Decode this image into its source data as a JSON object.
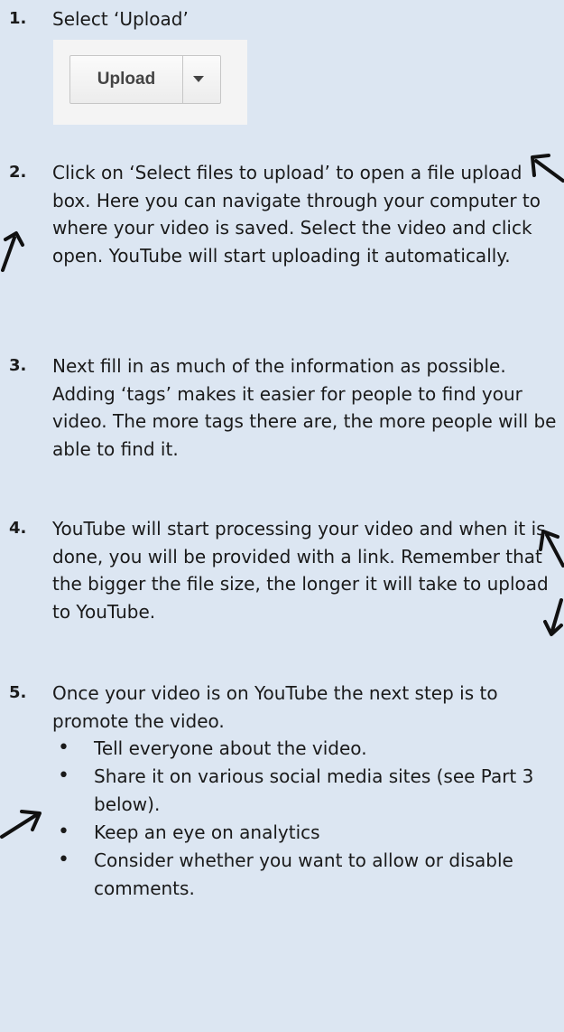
{
  "steps": [
    {
      "num": "1.",
      "text": "Select ‘Upload’"
    },
    {
      "num": "2.",
      "text": "Click on ‘Select files to upload’ to open a file upload box. Here you can navigate through your computer to where your video is saved. Select the video and click open. YouTube will start uploading it automatically."
    },
    {
      "num": "3.",
      "text": "Next fill in as much of the information as possible. Adding ‘tags’ makes it easier for people to find your video. The more tags there are, the more people will be able to find it."
    },
    {
      "num": "4.",
      "text": "YouTube will start processing your video and when it is done, you will be provided with a link. Remember that the bigger the file size, the longer it will take to upload to YouTube."
    },
    {
      "num": "5.",
      "text": "Once your video is on YouTube the next step is to promote the video."
    }
  ],
  "upload_button": {
    "label": "Upload",
    "dropdown_icon": "caret-down-icon"
  },
  "bullets": [
    "Tell everyone about the video.",
    "Share it on various social media sites (see Part 3 below).",
    "Keep an eye on analytics",
    "Consider whether you want to allow or disable comments."
  ],
  "bullet_symbol": "•",
  "colors": {
    "background": "#dce6f2",
    "arrow": "#111111"
  }
}
